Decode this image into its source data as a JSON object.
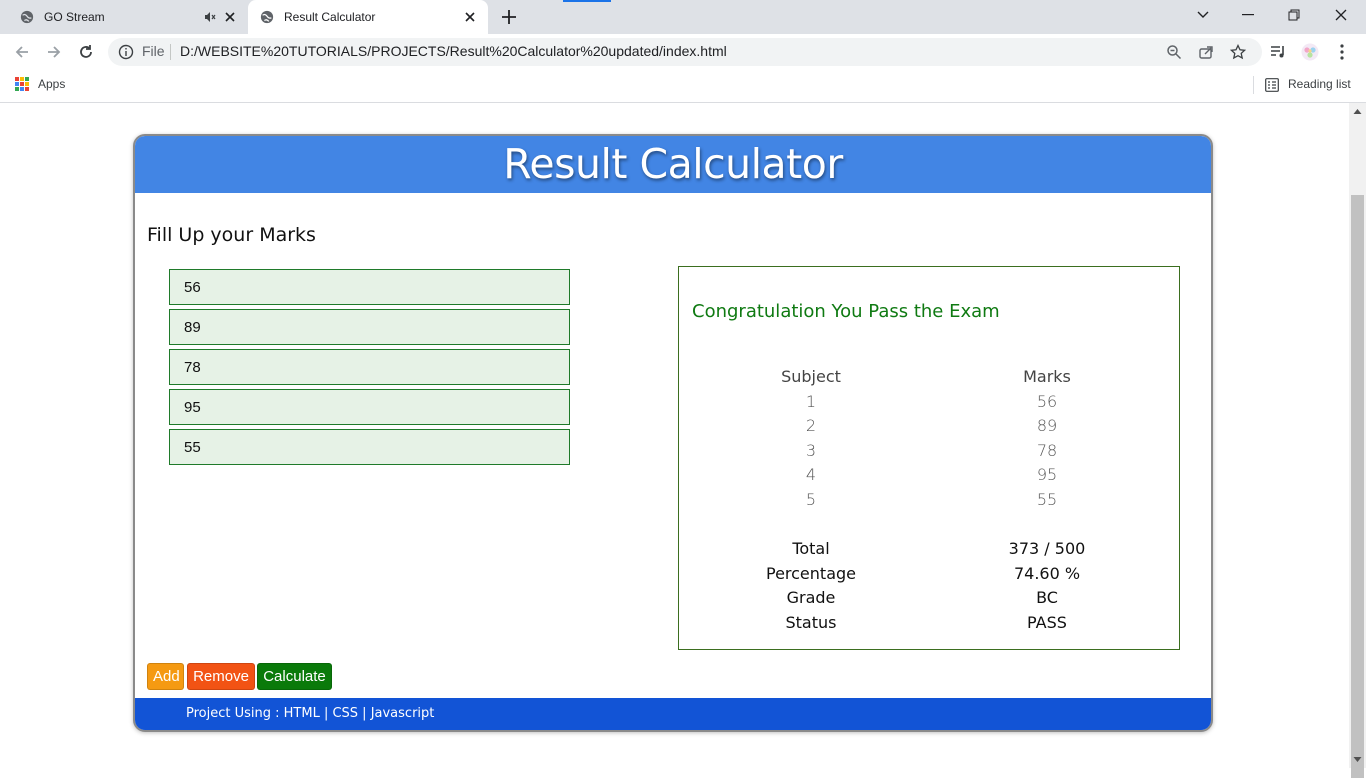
{
  "browser": {
    "tabs": [
      {
        "title": "GO Stream",
        "active": false
      },
      {
        "title": "Result Calculator",
        "active": true
      }
    ],
    "omnibox": {
      "scheme_label": "File",
      "url": "D:/WEBSITE%20TUTORIALS/PROJECTS/Result%20Calculator%20updated/index.html"
    },
    "bookmarks": {
      "apps_label": "Apps",
      "reading_list_label": "Reading list"
    }
  },
  "page": {
    "header_title": "Result Calculator",
    "fill_title": "Fill Up your Marks",
    "marks": [
      "56",
      "89",
      "78",
      "95",
      "55"
    ],
    "buttons": {
      "add": "Add",
      "remove": "Remove",
      "calculate": "Calculate"
    },
    "footer": "Project Using : HTML | CSS | Javascript",
    "colors": {
      "header": "#4285e4",
      "footer": "#1254d6",
      "add": "#f59a12",
      "remove": "#f25314",
      "calculate": "#0a7a0a",
      "congrats": "#0f7a12"
    }
  },
  "result": {
    "message": "Congratulation You Pass the Exam",
    "table": {
      "headers": [
        "Subject",
        "Marks"
      ],
      "rows": [
        [
          "1",
          "56"
        ],
        [
          "2",
          "89"
        ],
        [
          "3",
          "78"
        ],
        [
          "4",
          "95"
        ],
        [
          "5",
          "55"
        ]
      ]
    },
    "summary": {
      "total_label": "Total",
      "total_value": "373 / 500",
      "percentage_label": "Percentage",
      "percentage_value": "74.60 %",
      "grade_label": "Grade",
      "grade_value": "BC",
      "status_label": "Status",
      "status_value": "PASS"
    }
  }
}
